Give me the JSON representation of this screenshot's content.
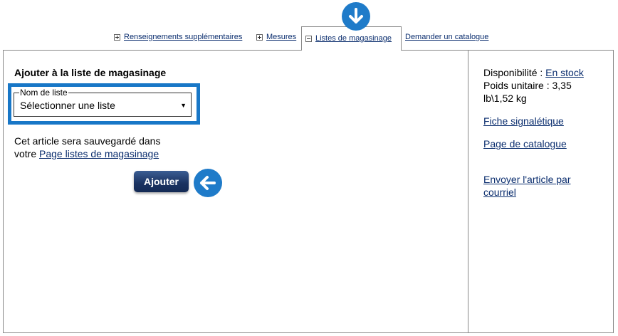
{
  "tabs": {
    "renseignements": "Renseignements supplémentaires",
    "mesures": "Mesures",
    "listes": "Listes de magasinage",
    "catalogue": "Demander un catalogue"
  },
  "main": {
    "title": "Ajouter à la liste de magasinage",
    "list_field": {
      "legend": "Nom de liste",
      "selected": "Sélectionner une liste",
      "caret": "▼"
    },
    "save_note_text": "Cet article sera sauvegardé dans",
    "save_note_prefix": "votre",
    "save_note_link": "Page listes de magasinage",
    "add_button": "Ajouter"
  },
  "sidebar": {
    "availability_label": "Disponibilité :",
    "availability_value": "En stock",
    "weight_line1": "Poids unitaire : 3,35",
    "weight_line2": "lb\\1,52 kg",
    "sds_link": "Fiche signalétique",
    "catalog_page_link": "Page de catalogue",
    "email_link_line1": "Envoyer l'article par",
    "email_link_line2": "courriel"
  },
  "annotations": {
    "arrow_color": "#1f7bc9",
    "icons": [
      "arrow-down-icon",
      "arrow-left-icon"
    ]
  }
}
